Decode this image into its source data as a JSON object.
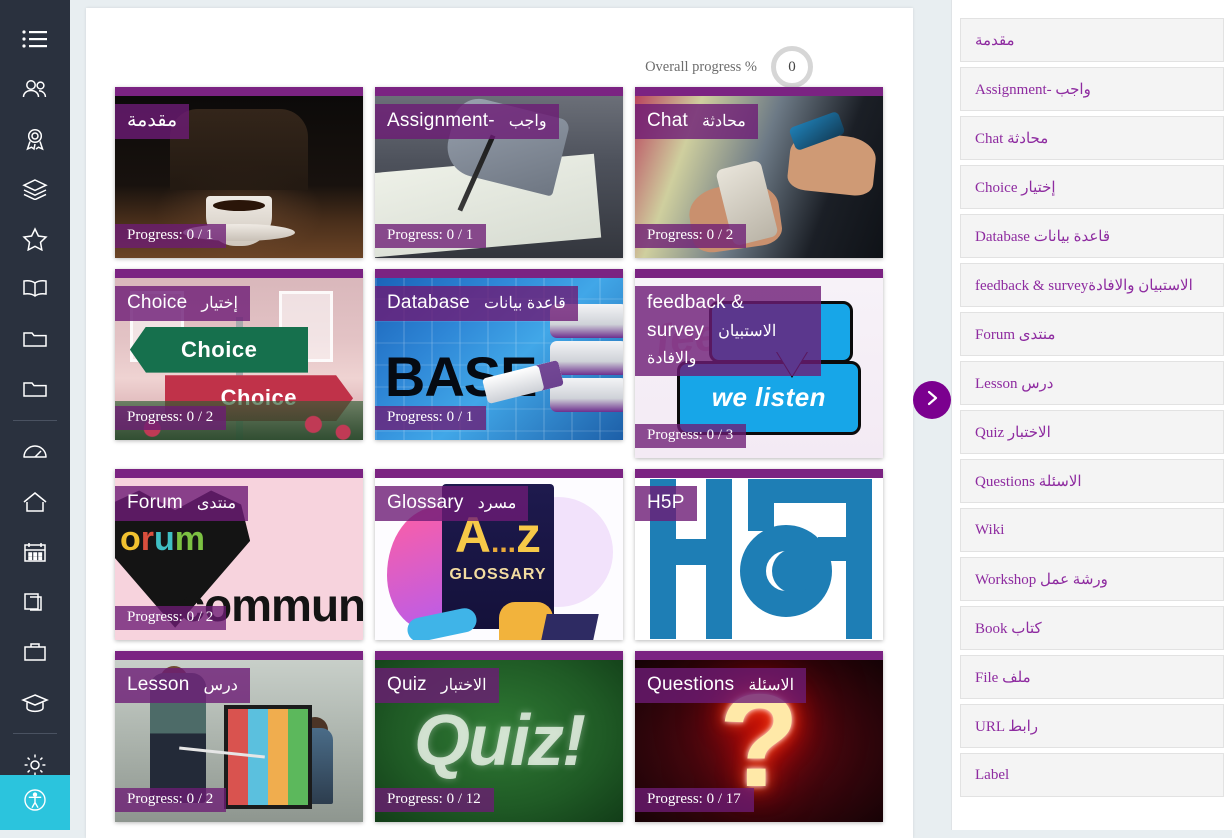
{
  "left_rail": {
    "icons": [
      {
        "name": "list-icon"
      },
      {
        "name": "users-icon"
      },
      {
        "name": "badge-icon"
      },
      {
        "name": "layers-icon"
      },
      {
        "name": "star-icon"
      },
      {
        "name": "book-open-icon"
      },
      {
        "name": "folder-icon"
      },
      {
        "name": "folder-alt-icon"
      },
      {
        "name": "dashboard-gauge-icon"
      },
      {
        "name": "home-icon"
      },
      {
        "name": "calendar-icon"
      },
      {
        "name": "files-icon"
      },
      {
        "name": "briefcase-icon"
      },
      {
        "name": "graduation-cap-icon"
      },
      {
        "name": "gear-icon"
      }
    ],
    "accessibility_icon": "accessibility-icon"
  },
  "header": {
    "progress_label": "Overall progress %",
    "progress_value": "0"
  },
  "drawer_toggle": {
    "icon": "chevron-right-icon"
  },
  "cards": [
    {
      "title_en": "مقدمة",
      "title_ar": "",
      "progress": "Progress: 0 / 1",
      "art": "coffee"
    },
    {
      "title_en": "Assignment-",
      "title_ar": "واجب",
      "progress": "Progress: 0 / 1",
      "art": "assignment"
    },
    {
      "title_en": "Chat",
      "title_ar": "محادثة",
      "progress": "Progress: 0 / 2",
      "art": "chat"
    },
    {
      "title_en": "Choice",
      "title_ar": "إختيار",
      "progress": "Progress: 0 / 2",
      "art": "choice",
      "sign_green": "Choice",
      "sign_red": "Choice"
    },
    {
      "title_en": "Database",
      "title_ar": "قاعدة بيانات",
      "progress": "Progress: 0 / 1",
      "art": "database",
      "art_text": "BASE"
    },
    {
      "title_en": "feedback & survey",
      "title_ar": "الاستبيان والافادة",
      "progress": "Progress: 0 / 3",
      "art": "feedback",
      "art_text": "we listen",
      "art_ghost": "feedback"
    },
    {
      "title_en": "Forum",
      "title_ar": "منتدى",
      "progress": "Progress: 0 / 2",
      "art": "forum",
      "art_text": "community"
    },
    {
      "title_en": "Glossary",
      "title_ar": "مسرد",
      "progress": "",
      "art": "glossary",
      "art_text": "GLOSSARY"
    },
    {
      "title_en": "H5P",
      "title_ar": "",
      "progress": "",
      "art": "h5p"
    },
    {
      "title_en": "Lesson",
      "title_ar": "درس",
      "progress": "Progress: 0 / 2",
      "art": "lesson"
    },
    {
      "title_en": "Quiz",
      "title_ar": "الاختبار",
      "progress": "Progress: 0 / 12",
      "art": "quiz",
      "art_text": "Quiz!"
    },
    {
      "title_en": "Questions",
      "title_ar": "الاسئلة",
      "progress": "Progress: 0 / 17",
      "art": "questions",
      "art_text": "?"
    }
  ],
  "drawer": {
    "items": [
      {
        "label": "مقدمة"
      },
      {
        "label": "Assignment- واجب"
      },
      {
        "label": "Chat محادثة"
      },
      {
        "label": "Choice إختيار"
      },
      {
        "label": "Database قاعدة بيانات"
      },
      {
        "label": "feedback & surveyالاستبيان والافادة"
      },
      {
        "label": "Forum منتدى"
      },
      {
        "label": "Lesson درس"
      },
      {
        "label": "Quiz الاختبار"
      },
      {
        "label": "Questions الاسئلة"
      },
      {
        "label": "Wiki"
      },
      {
        "label": "Workshop ورشة عمل"
      },
      {
        "label": "Book كتاب"
      },
      {
        "label": "File ملف"
      },
      {
        "label": "URL رابط"
      },
      {
        "label": "Label"
      }
    ]
  },
  "colors": {
    "brand_purple": "#7b2382",
    "badge_purple": "#6d1c75",
    "rail_dark": "#2a313e",
    "page_bg": "#e8eef1",
    "accessibility_cyan": "#2bc4dd",
    "drawer_link": "#8e2ba0"
  }
}
